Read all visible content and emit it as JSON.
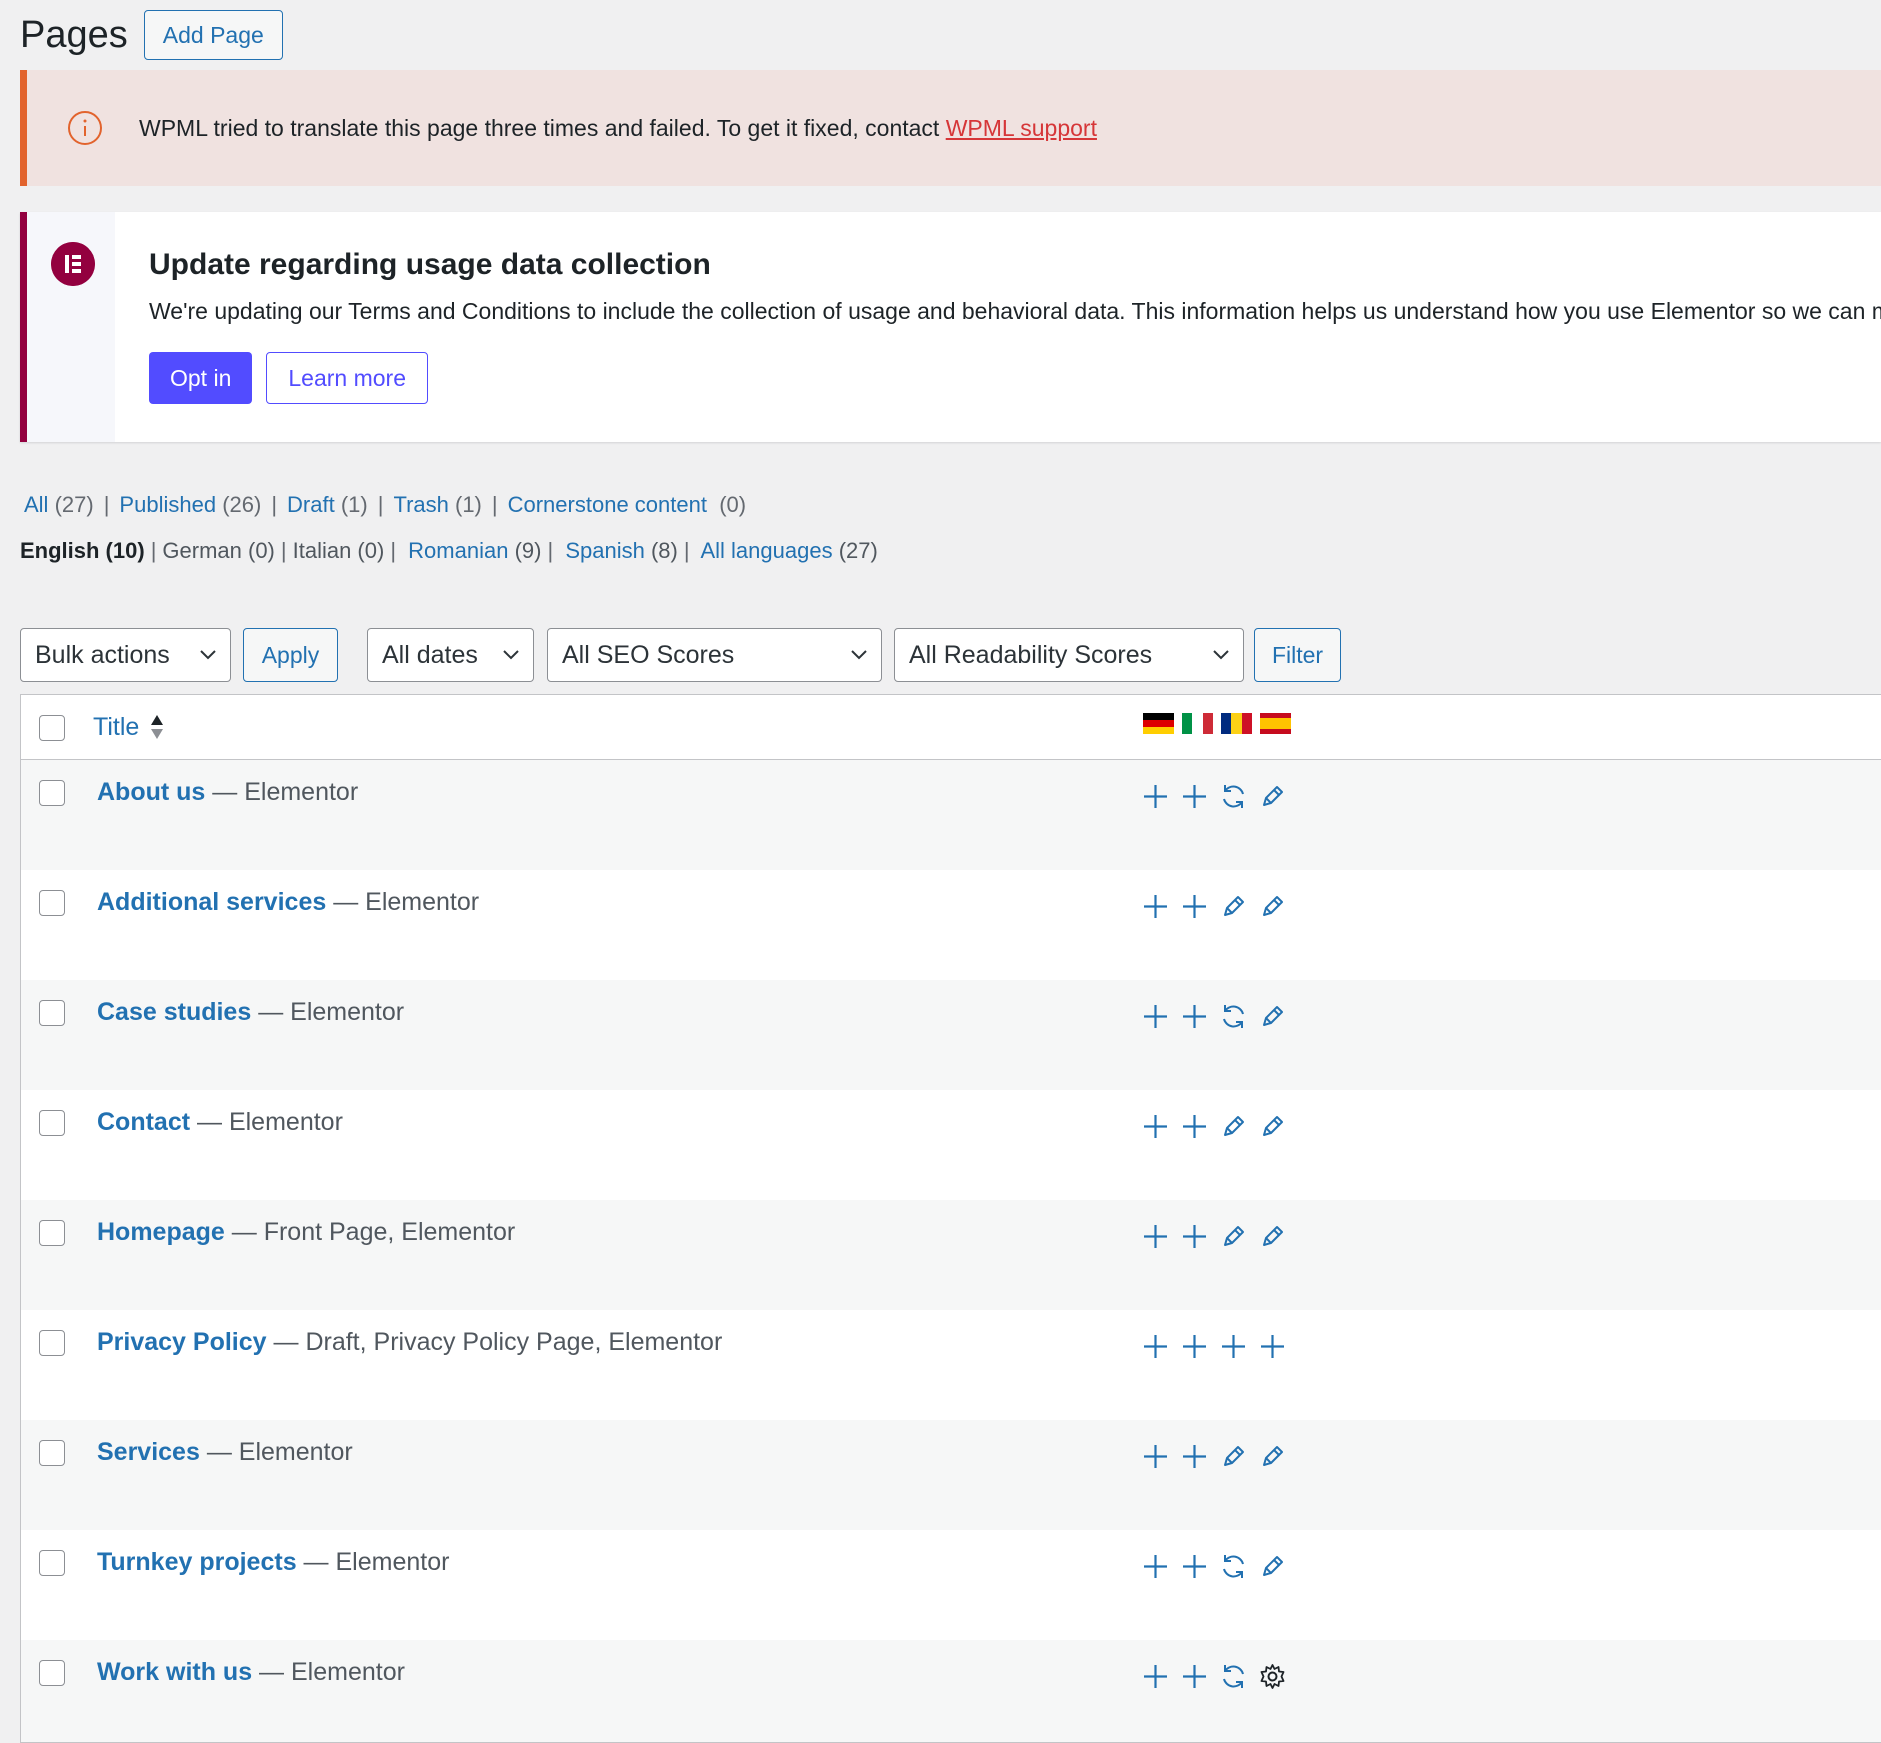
{
  "header": {
    "title": "Pages",
    "add_button": "Add Page"
  },
  "wpml_notice": {
    "message": "WPML tried to translate this page three times and failed. To get it fixed, contact ",
    "link": "WPML support",
    "icon": "info-icon"
  },
  "elementor_notice": {
    "title": "Update regarding usage data collection",
    "description": "We're updating our Terms and Conditions to include the collection of usage and behavioral data. This information helps us understand how you use Elementor so we can ma",
    "opt_in": "Opt in",
    "learn_more": "Learn more",
    "icon": "elementor-logo-icon"
  },
  "status_filters": [
    {
      "label": "All",
      "count": "(27)"
    },
    {
      "label": "Published",
      "count": "(26)"
    },
    {
      "label": "Draft",
      "count": "(1)"
    },
    {
      "label": "Trash",
      "count": "(1)"
    },
    {
      "label": "Cornerstone content",
      "count": "(0)"
    }
  ],
  "language_filters": {
    "current": "English (10)",
    "items": [
      {
        "label": "German (0)",
        "link": false
      },
      {
        "label": "Italian (0)",
        "link": false
      },
      {
        "label": "Romanian",
        "count": "(9)",
        "link": true
      },
      {
        "label": "Spanish",
        "count": "(8)",
        "link": true
      },
      {
        "label": "All languages",
        "count": "(27)",
        "link": true
      }
    ]
  },
  "toolbar": {
    "bulk_actions": "Bulk actions",
    "apply": "Apply",
    "dates": "All dates",
    "seo": "All SEO Scores",
    "readability": "All Readability Scores",
    "filter": "Filter"
  },
  "table": {
    "title_header": "Title",
    "flags": [
      "German",
      "Italian",
      "Romanian",
      "Spanish"
    ],
    "rows": [
      {
        "title": "About us",
        "state": " — Elementor",
        "actions": [
          "plus",
          "plus",
          "refresh",
          "pencil"
        ]
      },
      {
        "title": "Additional services",
        "state": " — Elementor",
        "actions": [
          "plus",
          "plus",
          "pencil",
          "pencil"
        ]
      },
      {
        "title": "Case studies",
        "state": " — Elementor",
        "actions": [
          "plus",
          "plus",
          "refresh",
          "pencil"
        ]
      },
      {
        "title": "Contact",
        "state": " — Elementor",
        "actions": [
          "plus",
          "plus",
          "pencil",
          "pencil"
        ]
      },
      {
        "title": "Homepage",
        "state": " — Front Page, Elementor",
        "actions": [
          "plus",
          "plus",
          "pencil",
          "pencil"
        ]
      },
      {
        "title": "Privacy Policy",
        "state": " — Draft, Privacy Policy Page, Elementor",
        "actions": [
          "plus",
          "plus",
          "plus",
          "plus"
        ]
      },
      {
        "title": "Services",
        "state": " — Elementor",
        "actions": [
          "plus",
          "plus",
          "pencil",
          "pencil"
        ]
      },
      {
        "title": "Turnkey projects",
        "state": " — Elementor",
        "actions": [
          "plus",
          "plus",
          "refresh",
          "pencil"
        ]
      },
      {
        "title": "Work with us",
        "state": " — Elementor",
        "actions": [
          "plus",
          "plus",
          "refresh",
          "gear"
        ]
      }
    ]
  },
  "colors": {
    "link": "#2271b1",
    "wpml_accent": "#e2632d",
    "elementor_brand": "#93003f",
    "elementor_button": "#524cff"
  }
}
